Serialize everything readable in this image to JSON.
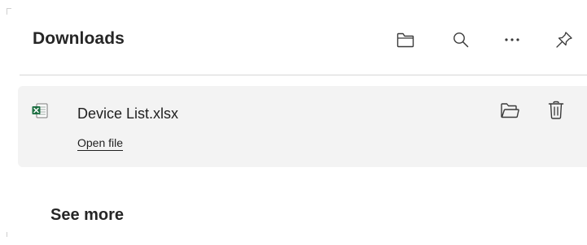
{
  "panel": {
    "title": "Downloads",
    "toolbar": [
      {
        "name": "open-downloads-folder",
        "icon": "folder-icon"
      },
      {
        "name": "search-downloads",
        "icon": "search-icon"
      },
      {
        "name": "more-options",
        "icon": "ellipsis-icon"
      },
      {
        "name": "pin-downloads",
        "icon": "pin-icon"
      }
    ]
  },
  "downloads": [
    {
      "file_name": "Device List.xlsx",
      "file_icon": "excel-file-icon",
      "action_label": "Open file",
      "item_actions": [
        {
          "name": "show-in-folder",
          "icon": "folder-icon"
        },
        {
          "name": "delete",
          "icon": "trash-icon"
        }
      ]
    }
  ],
  "footer": {
    "see_more_label": "See more"
  },
  "colors": {
    "background": "#ffffff",
    "item_background": "#f3f3f3",
    "text": "#1f1f1f",
    "divider": "#d6d6d6",
    "excel_green": "#1d6f42"
  }
}
